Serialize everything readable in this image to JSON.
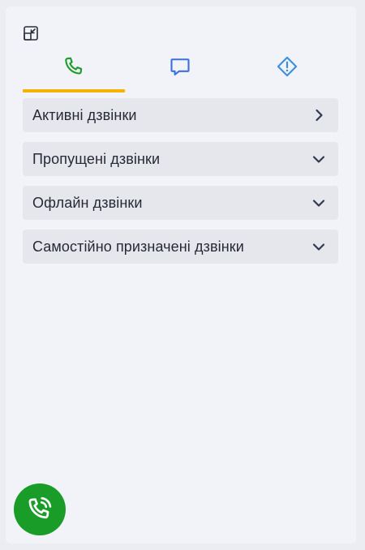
{
  "colors": {
    "accent_underline": "#f5b301",
    "phone_tab_icon": "#1a9c28",
    "chat_tab_icon": "#3b6fe0",
    "alert_tab_icon": "#3b8fe0",
    "fab_background": "#1a9c28"
  },
  "toolbar": {
    "minimize_icon": "minimize-window-icon"
  },
  "tabs": [
    {
      "icon": "phone-icon",
      "active": true
    },
    {
      "icon": "chat-bubble-icon",
      "active": false
    },
    {
      "icon": "warning-diamond-icon",
      "active": false
    }
  ],
  "sections": [
    {
      "label": "Активні дзвінки",
      "state": "collapsed",
      "chevron": "chevron-right-icon"
    },
    {
      "label": "Пропущені дзвінки",
      "state": "expanded",
      "chevron": "chevron-down-icon"
    },
    {
      "label": "Офлайн дзвінки",
      "state": "expanded",
      "chevron": "chevron-down-icon"
    },
    {
      "label": "Самостійно призначені дзвінки",
      "state": "expanded",
      "chevron": "chevron-down-icon"
    }
  ],
  "fab": {
    "icon": "phone-ringing-icon"
  }
}
